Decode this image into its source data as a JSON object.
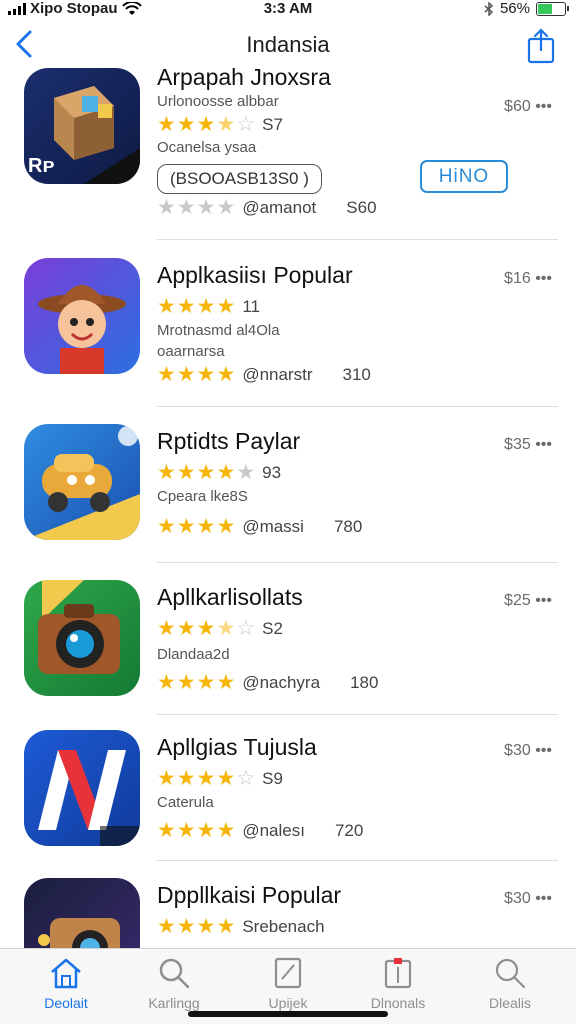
{
  "status": {
    "carrier": "Xipo Stopau",
    "time": "3:3 AM",
    "battery": "56%",
    "battery_level": 0.56
  },
  "nav": {
    "title": "Indansia"
  },
  "rows": [
    {
      "name": "Arpapah Jnoxsra",
      "line1": "Urlonoosse albbar",
      "rating_text": "S7",
      "line2": "Ocanelsa ysaa",
      "pill": "(BSOOASB13S0 )",
      "button": "HiNO",
      "stars2_text": "@amanot",
      "stars2_count": "S60",
      "price": "$60 •••",
      "stars1": 3.5,
      "stars2": 0
    },
    {
      "name": "Applkasiisı Popular",
      "rating_text": "11",
      "line1": "Mrotnasmd al4Ola",
      "line2": "oaarnarsa",
      "stars2_text": "@nnarstr",
      "stars2_count": "310",
      "price": "$16 •••",
      "stars1": 4,
      "stars2": 4
    },
    {
      "name": "Rptidts Paylar",
      "rating_text": "93",
      "line1": "Cpeara lke8S",
      "stars2_text": "@massi",
      "stars2_count": "780",
      "price": "$35 •••",
      "stars1": 4,
      "stars2": 4
    },
    {
      "name": "Apllkarlisollats",
      "rating_text": "S2",
      "line1": "Dlandaa2d",
      "stars2_text": "@nachyra",
      "stars2_count": "180",
      "price": "$25 •••",
      "stars1": 3.5,
      "stars2": 4
    },
    {
      "name": "Apllgias Tujusla",
      "rating_text": "S9",
      "line1": "Caterula",
      "stars2_text": "@nalesı",
      "stars2_count": "720",
      "price": "$30 •••",
      "stars1": 4,
      "stars2": 4
    },
    {
      "name": "Dppllkaisi Popular",
      "rating_text": "Srebenach",
      "price": "$30 •••",
      "stars1": 4
    }
  ],
  "tabs": [
    {
      "label": "Deolait",
      "icon": "home-icon",
      "active": true
    },
    {
      "label": "Karlingg",
      "icon": "search-icon",
      "active": false
    },
    {
      "label": "Upijek",
      "icon": "note-icon",
      "active": false
    },
    {
      "label": "Dlnonals",
      "icon": "calendar-icon",
      "active": false
    },
    {
      "label": "Dlealis",
      "icon": "search-icon",
      "active": false
    }
  ],
  "colors": {
    "accent": "#1a73e8",
    "star": "#f5b50a",
    "button_border": "#2b8cd8"
  }
}
